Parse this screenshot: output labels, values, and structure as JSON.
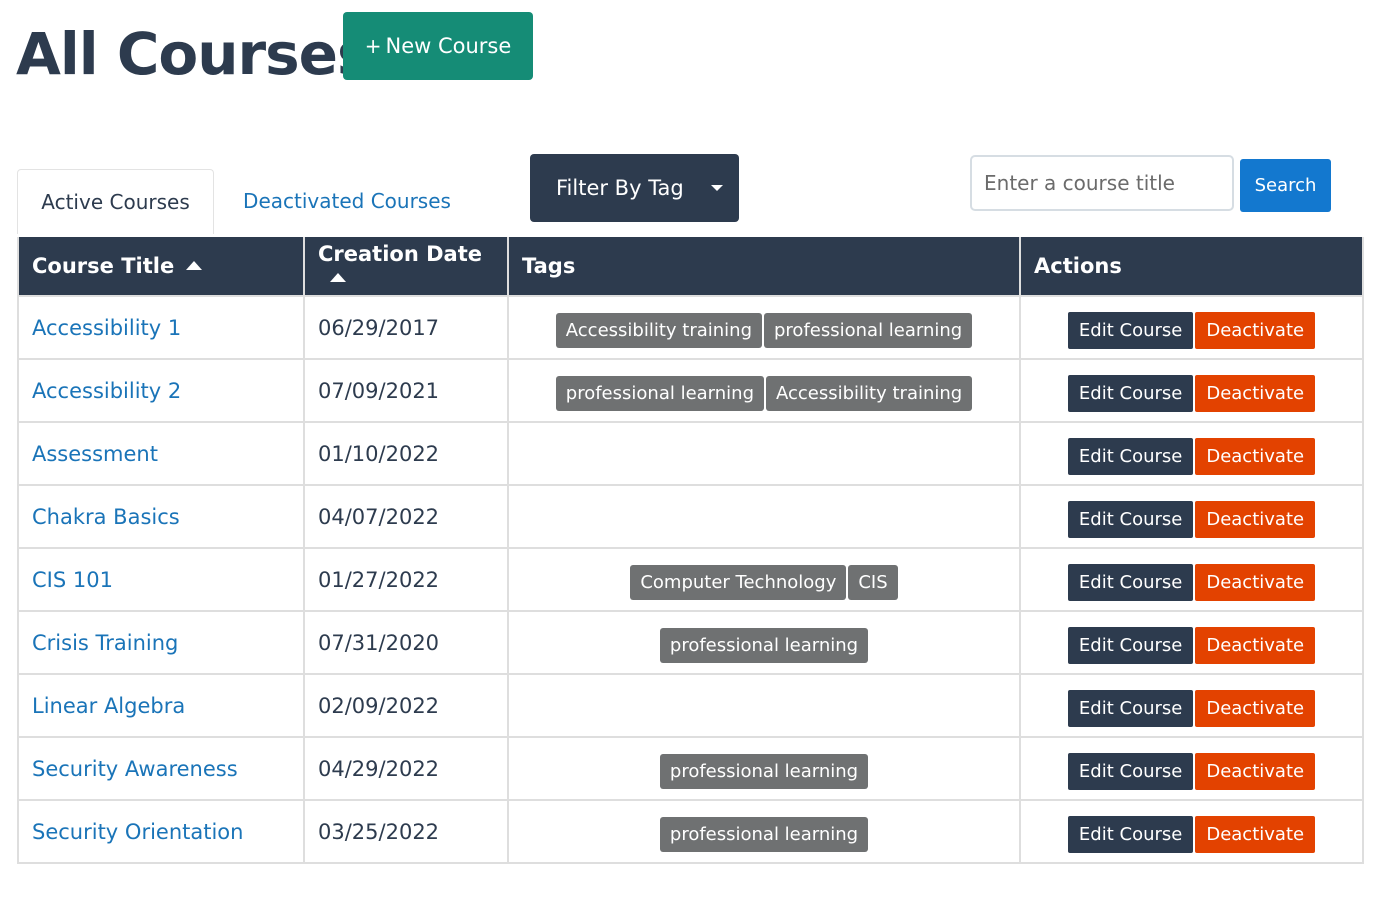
{
  "header": {
    "title": "All Courses",
    "new_course_label": "New Course",
    "new_course_icon": "plus-icon"
  },
  "tabs": {
    "active_label": "Active Courses",
    "deactivated_label": "Deactivated Courses"
  },
  "filter": {
    "label": "Filter By Tag",
    "icon": "caret-down-icon"
  },
  "search": {
    "placeholder": "Enter a course title",
    "button_label": "Search"
  },
  "table": {
    "headers": {
      "title": "Course Title",
      "date": "Creation Date",
      "tags": "Tags",
      "actions": "Actions"
    },
    "rows": [
      {
        "title": "Accessibility 1",
        "date": "06/29/2017",
        "tags": [
          "Accessibility training",
          "professional learning"
        ]
      },
      {
        "title": "Accessibility 2",
        "date": "07/09/2021",
        "tags": [
          "professional learning",
          "Accessibility training"
        ]
      },
      {
        "title": "Assessment",
        "date": "01/10/2022",
        "tags": []
      },
      {
        "title": "Chakra Basics",
        "date": "04/07/2022",
        "tags": []
      },
      {
        "title": "CIS 101",
        "date": "01/27/2022",
        "tags": [
          "Computer Technology",
          "CIS"
        ]
      },
      {
        "title": "Crisis Training",
        "date": "07/31/2020",
        "tags": [
          "professional learning"
        ]
      },
      {
        "title": "Linear Algebra",
        "date": "02/09/2022",
        "tags": []
      },
      {
        "title": "Security Awareness",
        "date": "04/29/2022",
        "tags": [
          "professional learning"
        ]
      },
      {
        "title": "Security Orientation",
        "date": "03/25/2022",
        "tags": [
          "professional learning"
        ]
      }
    ],
    "edit_label": "Edit Course",
    "deactivate_label": "Deactivate"
  },
  "colors": {
    "primary_dark": "#2d3b4e",
    "new_course_green": "#158c76",
    "link_blue": "#1a74b8",
    "search_blue": "#1378cf",
    "deactivate_orange": "#e34200",
    "tag_gray": "#6f7172"
  }
}
